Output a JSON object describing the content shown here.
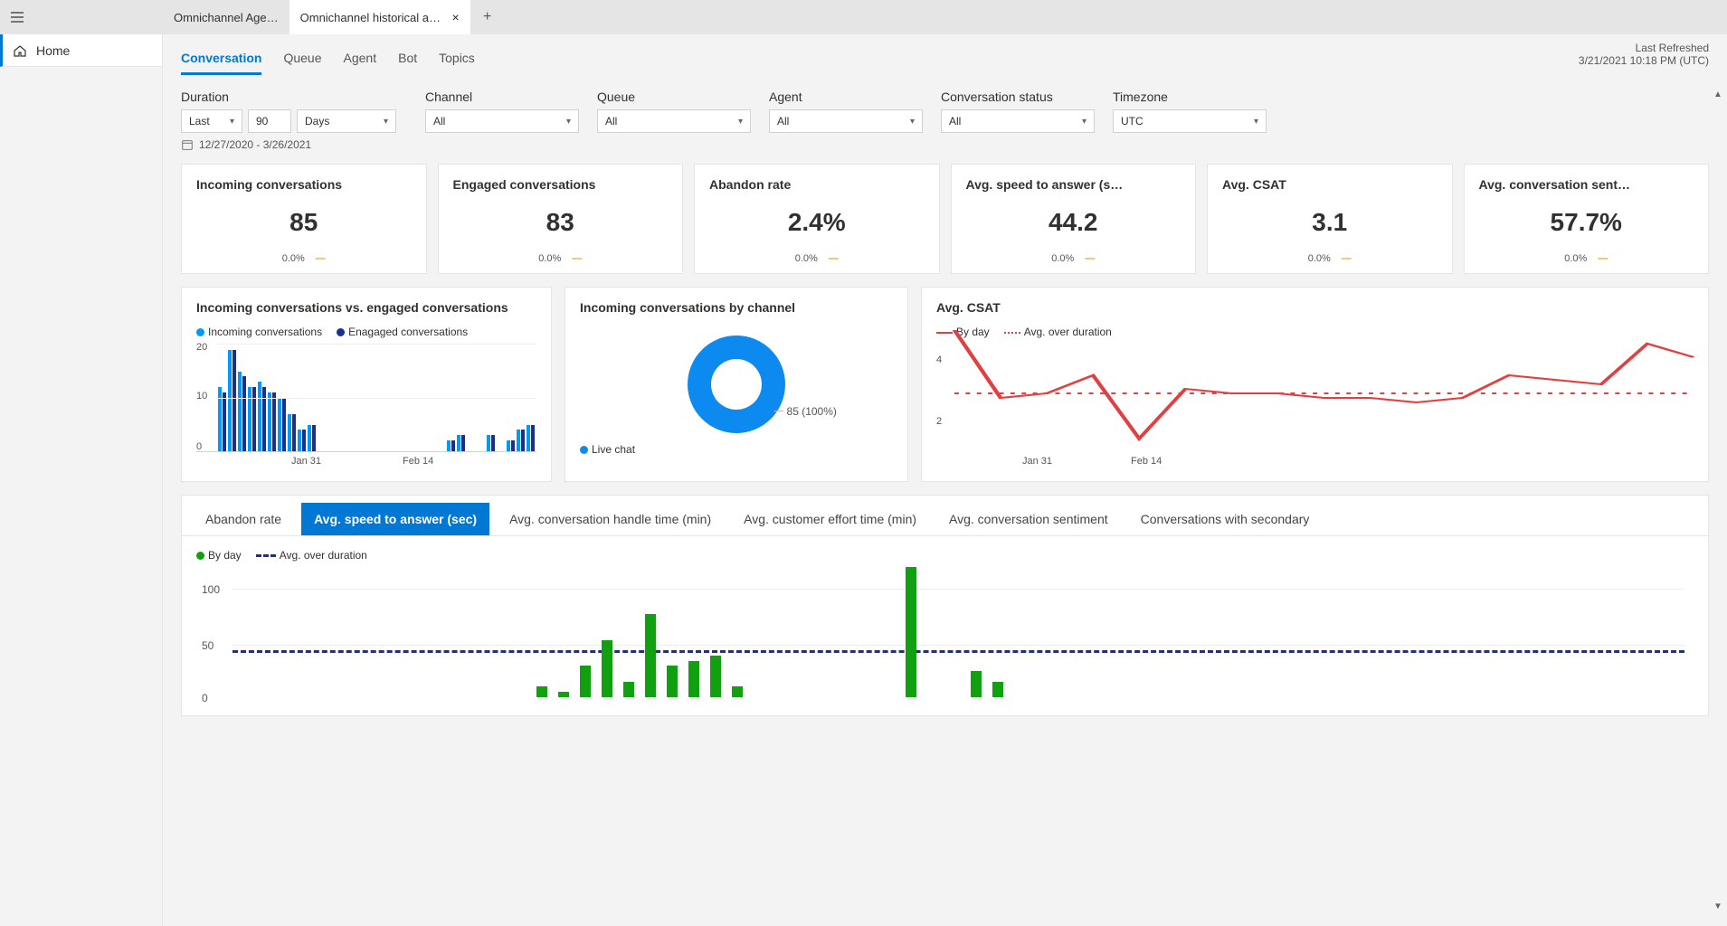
{
  "tabs": {
    "inactive_label": "Omnichannel Age…",
    "active_label": "Omnichannel historical an…"
  },
  "sidebar": {
    "home": "Home"
  },
  "subnav": {
    "tabs": [
      "Conversation",
      "Queue",
      "Agent",
      "Bot",
      "Topics"
    ],
    "active_index": 0,
    "refreshed_label": "Last Refreshed",
    "refreshed_value": "3/21/2021 10:18 PM (UTC)"
  },
  "filters": {
    "duration": {
      "label": "Duration",
      "mode": "Last",
      "count": "90",
      "unit": "Days",
      "range": "12/27/2020 - 3/26/2021"
    },
    "channel": {
      "label": "Channel",
      "value": "All"
    },
    "queue": {
      "label": "Queue",
      "value": "All"
    },
    "agent": {
      "label": "Agent",
      "value": "All"
    },
    "status": {
      "label": "Conversation status",
      "value": "All"
    },
    "timezone": {
      "label": "Timezone",
      "value": "UTC"
    }
  },
  "kpi": [
    {
      "title": "Incoming conversations",
      "value": "85",
      "delta": "0.0%"
    },
    {
      "title": "Engaged conversations",
      "value": "83",
      "delta": "0.0%"
    },
    {
      "title": "Abandon rate",
      "value": "2.4%",
      "delta": "0.0%"
    },
    {
      "title": "Avg. speed to answer (s…",
      "value": "44.2",
      "delta": "0.0%"
    },
    {
      "title": "Avg. CSAT",
      "value": "3.1",
      "delta": "0.0%"
    },
    {
      "title": "Avg. conversation sent…",
      "value": "57.7%",
      "delta": "0.0%"
    }
  ],
  "charts": {
    "inc_vs_eng": {
      "title": "Incoming conversations vs. engaged conversations",
      "legend": [
        "Incoming conversations",
        "Enagaged conversations"
      ],
      "y_ticks": [
        "20",
        "10",
        "0"
      ],
      "x_ticks": [
        "Jan 31",
        "Feb 14"
      ]
    },
    "by_channel": {
      "title": "Incoming conversations by channel",
      "slice_label": "85 (100%)",
      "legend": "Live chat"
    },
    "csat": {
      "title": "Avg. CSAT",
      "legend": [
        "By day",
        "Avg. over duration"
      ],
      "y_ticks": [
        "4",
        "2"
      ],
      "x_ticks": [
        "Jan 31",
        "Feb 14"
      ]
    }
  },
  "metric_tabs": {
    "items": [
      "Abandon rate",
      "Avg. speed to answer (sec)",
      "Avg. conversation handle time (min)",
      "Avg. customer effort time (min)",
      "Avg. conversation sentiment",
      "Conversations with secondary"
    ],
    "active_index": 1,
    "legend": [
      "By day",
      "Avg. over duration"
    ],
    "y_ticks": [
      "100",
      "50",
      "0"
    ]
  },
  "chart_data": [
    {
      "type": "bar",
      "id": "incoming_vs_engaged",
      "title": "Incoming conversations vs. engaged conversations",
      "series": [
        {
          "name": "Incoming conversations",
          "color": "#0099ff",
          "values": [
            12,
            19,
            15,
            12,
            13,
            11,
            10,
            7,
            4,
            5,
            0,
            0,
            0,
            0,
            0,
            0,
            0,
            0,
            0,
            0,
            0,
            0,
            0,
            2,
            3,
            0,
            0,
            3,
            0,
            2,
            4,
            5
          ]
        },
        {
          "name": "Enagaged conversations",
          "color": "#1a2f8f",
          "values": [
            11,
            19,
            14,
            12,
            12,
            11,
            10,
            7,
            4,
            5,
            0,
            0,
            0,
            0,
            0,
            0,
            0,
            0,
            0,
            0,
            0,
            0,
            0,
            2,
            3,
            0,
            0,
            3,
            0,
            2,
            4,
            5
          ]
        }
      ],
      "x_ticks": [
        "Jan 31",
        "Feb 14"
      ],
      "ylim": [
        0,
        20
      ]
    },
    {
      "type": "pie",
      "id": "incoming_by_channel",
      "title": "Incoming conversations by channel",
      "slices": [
        {
          "name": "Live chat",
          "value": 85,
          "pct": 100,
          "color": "#0d8af0"
        }
      ]
    },
    {
      "type": "line",
      "id": "avg_csat",
      "title": "Avg. CSAT",
      "series": [
        {
          "name": "By day",
          "color": "#e04040",
          "values": [
            4.5,
            3.0,
            3.1,
            3.5,
            2.1,
            3.2,
            3.1,
            3.1,
            3.0,
            3.0,
            2.9,
            3.0,
            3.5,
            3.4,
            3.3,
            4.2,
            3.9
          ]
        },
        {
          "name": "Avg. over duration",
          "style": "dotted",
          "color": "#e04040",
          "value": 3.1
        }
      ],
      "x_ticks": [
        "Jan 31",
        "Feb 14"
      ],
      "ylim": [
        2,
        4
      ]
    },
    {
      "type": "bar",
      "id": "avg_speed_to_answer",
      "title": "Avg. speed to answer (sec)",
      "series": [
        {
          "name": "By day",
          "color": "#10a010",
          "values": [
            0,
            0,
            0,
            0,
            0,
            0,
            0,
            0,
            0,
            0,
            0,
            0,
            0,
            0,
            10,
            5,
            30,
            55,
            15,
            80,
            30,
            35,
            40,
            10,
            0,
            0,
            0,
            0,
            0,
            0,
            0,
            125,
            0,
            0,
            25,
            15,
            0,
            0,
            0,
            0,
            0,
            0,
            0,
            0,
            0,
            0,
            0,
            0,
            0,
            0
          ]
        },
        {
          "name": "Avg. over duration",
          "style": "dashed",
          "color": "#1a2f8f",
          "value": 44.2
        }
      ],
      "ylim": [
        0,
        100
      ]
    }
  ]
}
